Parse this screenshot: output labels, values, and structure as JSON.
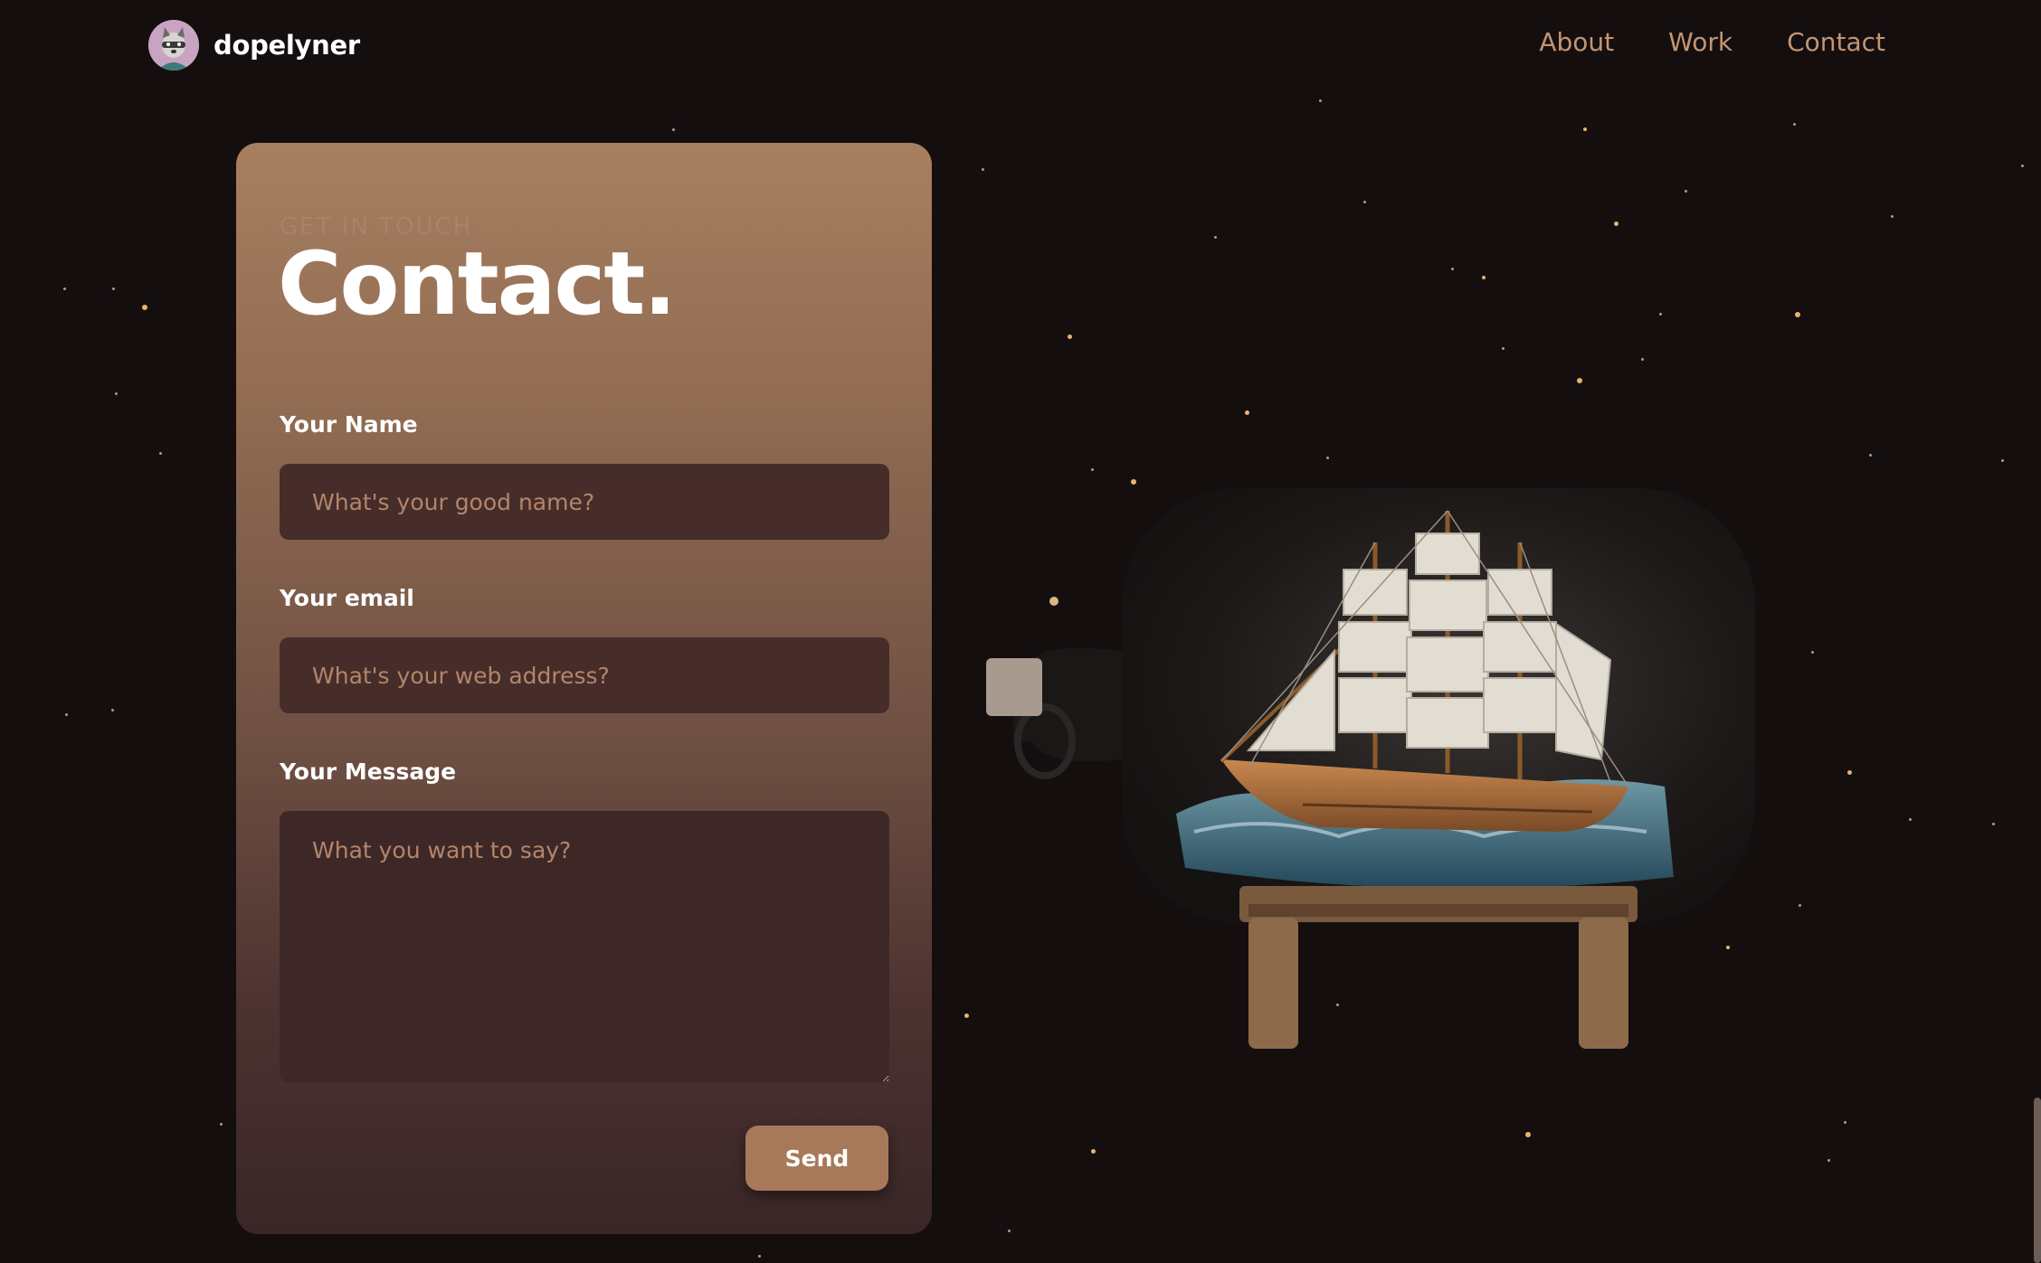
{
  "brand": {
    "name": "dopelyner"
  },
  "nav": {
    "items": [
      {
        "label": "About"
      },
      {
        "label": "Work"
      },
      {
        "label": "Contact"
      }
    ]
  },
  "contact": {
    "kicker": "Get in touch",
    "title": "Contact.",
    "name_label": "Your Name",
    "name_placeholder": "What's your good name?",
    "email_label": "Your email",
    "email_placeholder": "What's your web address?",
    "message_label": "Your Message",
    "message_placeholder": "What you want to say?",
    "send_label": "Send"
  },
  "colors": {
    "accent": "#a7795a",
    "background": "#140e0f",
    "nav_link": "#c49572"
  },
  "icons": {
    "avatar": "raccoon-avatar",
    "scene": "ship-in-bottle-illustration"
  }
}
